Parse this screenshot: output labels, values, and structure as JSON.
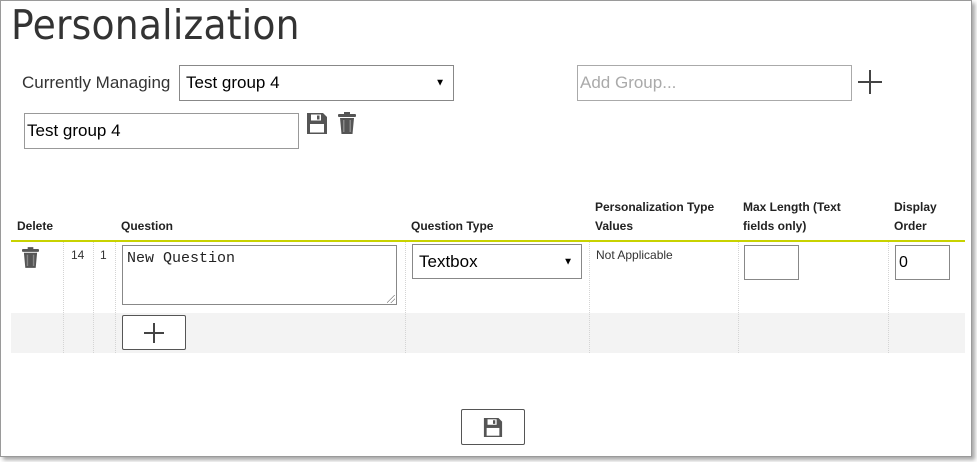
{
  "page": {
    "title": "Personalization"
  },
  "managing": {
    "label": "Currently Managing",
    "selected_group": "Test group 4",
    "add_group_placeholder": "Add Group...",
    "group_name_value": "Test group 4"
  },
  "table": {
    "headers": {
      "delete": "Delete",
      "question": "Question",
      "question_type": "Question Type",
      "personalization_type_values_1": "Personalization Type",
      "personalization_type_values_2": "Values",
      "max_length_1": "Max Length (Text",
      "max_length_2": "fields only)",
      "display_order_1": "Display",
      "display_order_2": "Order"
    },
    "rows": [
      {
        "id": "14",
        "seq": "1",
        "question": "New Question",
        "question_type": "Textbox",
        "personalization_type_values": "Not Applicable",
        "max_length": "",
        "display_order": "0"
      }
    ]
  },
  "icons": {
    "add_group": "plus-icon",
    "save_group": "floppy-disk-icon",
    "delete_group": "trash-icon",
    "delete_row": "trash-icon",
    "add_question": "plus-icon",
    "save_all": "floppy-disk-icon"
  },
  "colors": {
    "header_rule": "#c8d200"
  }
}
